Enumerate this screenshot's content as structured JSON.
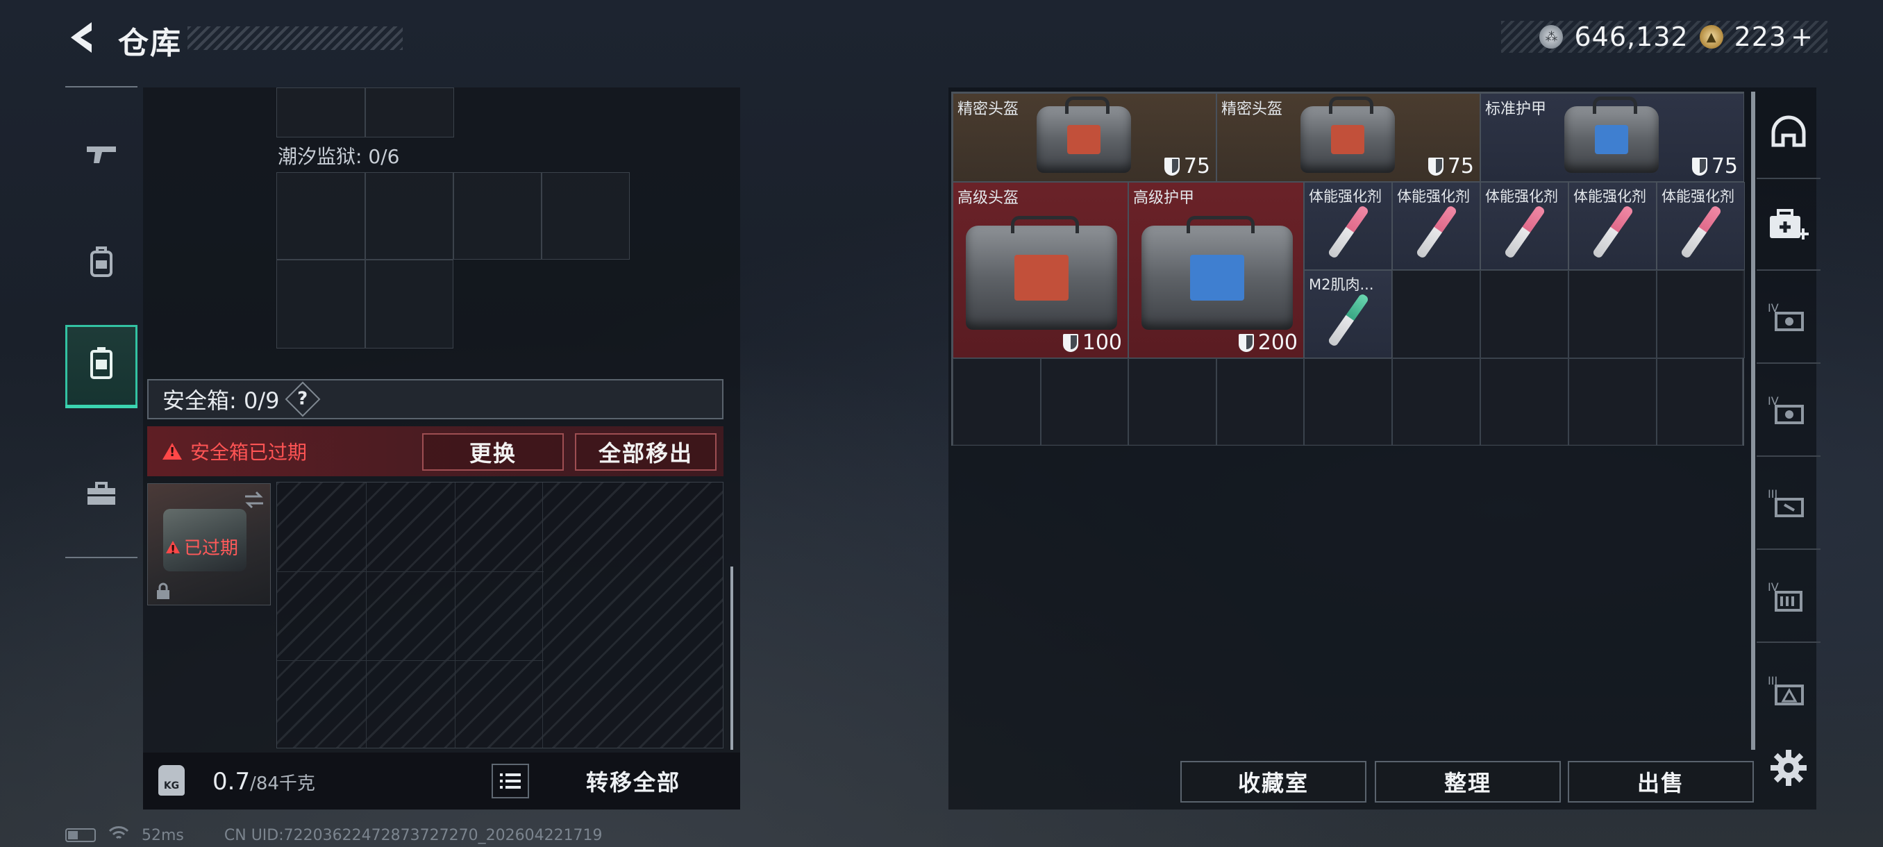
{
  "header": {
    "title": "仓库",
    "currency": [
      {
        "icon": "silver-coin-icon",
        "value": "646,132"
      },
      {
        "icon": "gold-coin-icon",
        "value": "223"
      }
    ],
    "add_label": "+"
  },
  "left_nav": [
    {
      "icon": "gun-icon",
      "active": false
    },
    {
      "icon": "backpack-icon",
      "active": false
    },
    {
      "icon": "safe-box-icon",
      "active": true
    },
    {
      "icon": "toolbox-icon",
      "active": false
    }
  ],
  "storage": {
    "prison_label": "潮汐监狱: 0/6",
    "safe_title": "安全箱: 0/9",
    "help_label": "?",
    "expired_notice": "安全箱已过期",
    "replace_label": "更换",
    "remove_all_label": "全部移出",
    "item_expired_label": "已过期"
  },
  "footer_left": {
    "weight_icon_label": "KG",
    "weight_value": "0.7",
    "weight_max": "/84千克",
    "transfer_all_label": "转移全部"
  },
  "stash_items": [
    {
      "name": "精密头盔",
      "durability": "75",
      "bg": "brown",
      "patch": "#c2503a"
    },
    {
      "name": "精密头盔",
      "durability": "75",
      "bg": "brown",
      "patch": "#c2503a"
    },
    {
      "name": "标准护甲",
      "durability": "75",
      "bg": "navy",
      "patch": "#3f7fd0"
    },
    {
      "name": "高级头盔",
      "durability": "100",
      "bg": "red",
      "patch": "#c2503a"
    },
    {
      "name": "高级护甲",
      "durability": "200",
      "bg": "red",
      "patch": "#3f7fd0"
    },
    {
      "name": "体能强化剂"
    },
    {
      "name": "体能强化剂"
    },
    {
      "name": "体能强化剂"
    },
    {
      "name": "体能强化剂"
    },
    {
      "name": "体能强化剂"
    },
    {
      "name": "M2肌肉..."
    }
  ],
  "bottom_buttons": {
    "collection_label": "收藏室",
    "sort_label": "整理",
    "sell_label": "出售"
  },
  "tools": [
    {
      "icon": "helmet-slot-icon"
    },
    {
      "icon": "medkit-add-icon"
    },
    {
      "icon": "armor-iv-icon"
    },
    {
      "icon": "armor-iv-alt-icon"
    },
    {
      "icon": "armor-iii-icon"
    },
    {
      "icon": "rig-iv-icon"
    },
    {
      "icon": "rig-iii-icon"
    }
  ],
  "status": {
    "ping": "52ms",
    "uid": "CN UID:7220362247287372727​0_202604221719"
  },
  "colors": {
    "accent": "#33c2a2",
    "warning": "#ff4848",
    "rarity_brown": "#4a3c2f",
    "rarity_red": "#6a2228",
    "rarity_navy": "#2e3446"
  }
}
